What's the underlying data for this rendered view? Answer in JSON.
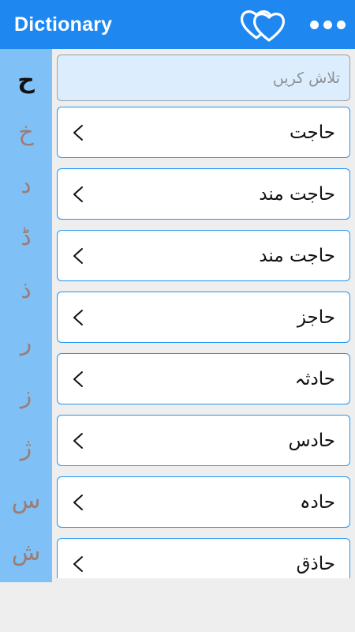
{
  "app": {
    "title": "Dictionary"
  },
  "toolbar": {
    "favorites_icon": "hearts-icon",
    "more_icon": "three-dots-icon"
  },
  "sidebar": {
    "letters": [
      "ح",
      "خ",
      "د",
      "ڈ",
      "ذ",
      "ر",
      "ز",
      "ژ",
      "س",
      "ش"
    ],
    "active_index": 0
  },
  "search": {
    "placeholder": "تلاش کریں",
    "value": ""
  },
  "words": [
    "حاجت",
    "حاجت مند",
    "حاجت مند",
    "حاجز",
    "حادثہ",
    "حادس",
    "حادہ",
    "حاذق"
  ],
  "colors": {
    "appbar": "#1e88f0",
    "sidebar": "#7fc1f7",
    "item_border": "#2196f3",
    "search_bg": "#dceefd"
  }
}
